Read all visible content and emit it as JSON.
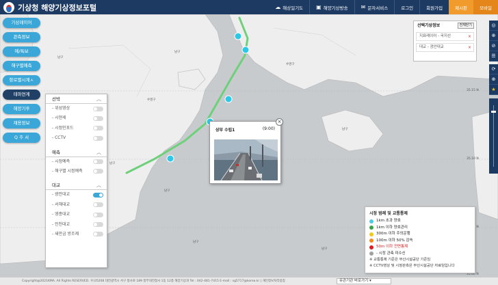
{
  "header": {
    "brand": "기상청 해양기상정보포털",
    "nav": [
      {
        "label": "해상일기도",
        "icon": "cloud-icon"
      },
      {
        "label": "해양기상방송",
        "icon": "radio-icon"
      },
      {
        "label": "문자서비스",
        "icon": "message-icon"
      },
      {
        "label": "로그인",
        "icon": ""
      },
      {
        "label": "회원가입",
        "icon": ""
      },
      {
        "label": "제시판",
        "icon": ""
      },
      {
        "label": "모바일",
        "icon": ""
      }
    ]
  },
  "left_menu": [
    {
      "label": "기상레이어"
    },
    {
      "label": "관측정보"
    },
    {
      "label": "예/특보"
    },
    {
      "label": "해구별예측"
    },
    {
      "label": "항로별시계ㅅ"
    },
    {
      "label": "테마연계"
    },
    {
      "label": "해양기후"
    },
    {
      "label": "재용정보"
    },
    {
      "label": "Q 주 서"
    }
  ],
  "layer_panel": {
    "groups": [
      {
        "label": "선박",
        "items": [
          {
            "label": "- 위성영상",
            "on": false
          },
          {
            "label": "- 시현세",
            "on": false
          },
          {
            "label": "- 시정인포드",
            "on": false
          },
          {
            "label": "- CCTV",
            "on": false
          }
        ]
      },
      {
        "label": "예측",
        "items": [
          {
            "label": "- 시정예측",
            "on": false
          },
          {
            "label": "- 해구별 시정예측",
            "on": false
          }
        ]
      },
      {
        "label": "대교",
        "items": [
          {
            "label": "- 광안대교",
            "on": true
          },
          {
            "label": "- 서해대교",
            "on": false
          },
          {
            "label": "- 영종대교",
            "on": false
          },
          {
            "label": "- 인천대교",
            "on": false
          },
          {
            "label": "- 새만금 방조제",
            "on": false
          }
        ]
      }
    ]
  },
  "popup": {
    "title": "상부 수립1",
    "time": "(9:00)",
    "close": "×"
  },
  "selected_panel": {
    "title": "선택기상정보",
    "close_label": "전체닫기",
    "items": [
      {
        "label": "지표레이어 - 국지선"
      },
      {
        "label": "대교 - 광안대교"
      }
    ]
  },
  "right_tools": [
    "◎",
    "⊕",
    "⊘",
    "☰",
    "⟳",
    "⊕",
    "★"
  ],
  "legend": {
    "title": "시정 범례 및 교통통제",
    "items": [
      {
        "color": "#4fc8ea",
        "label": "1km 초과 양호"
      },
      {
        "color": "#3aa34a",
        "label": "1km 이하 양호관리"
      },
      {
        "color": "#f2c81c",
        "label": "300m 이하 주의운행"
      },
      {
        "color": "#f28c1c",
        "label": "100m 이하 50% 감속"
      },
      {
        "color": "#d92020",
        "label": "50m 이하 전면통제",
        "red": true
      },
      {
        "color": "#a0a0a0",
        "label": "- 시정 관측 미수신"
      }
    ],
    "notes": [
      "※ 교통통제 기준은 부산시설공단 기준임",
      "※ CCTV영상 및 시정관측은 부산시설공단 자료임입니다"
    ]
  },
  "footer": {
    "copyright": "Copyright@2021KMA. All Rights RESERVED. 우)35208 대전광역시 서구 청사로 189 정부대전청사 1동 12층 해양기상과 Tel : 042-481-7415 E-mail : sg5717@korea.kr   |   개인정보처리방침",
    "select": "유관기관 바로가기"
  },
  "map_labels": [
    "남구",
    "남구",
    "수영구",
    "남구",
    "남구",
    "남구",
    "남구",
    "남구",
    "수영구"
  ],
  "map_coords": [
    "35.15 N",
    "35.10 N",
    "35.05 N",
    "35.00 N"
  ]
}
